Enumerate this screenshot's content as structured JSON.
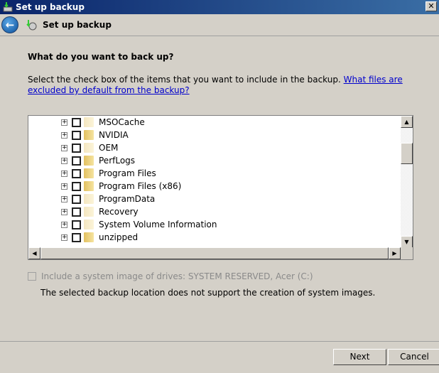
{
  "window": {
    "title": "Set up backup",
    "close": "✕"
  },
  "nav": {
    "title": "Set up backup",
    "back": "←"
  },
  "main": {
    "heading": "What do you want to back up?",
    "description": "Select the check box of the items that you want to include in the backup. ",
    "link": "What files are excluded by default from the backup?",
    "items": [
      {
        "label": "MSOCache",
        "hidden": true,
        "checked": false
      },
      {
        "label": "NVIDIA",
        "hidden": false,
        "checked": false
      },
      {
        "label": "OEM",
        "hidden": true,
        "checked": false
      },
      {
        "label": "PerfLogs",
        "hidden": false,
        "checked": false
      },
      {
        "label": "Program Files",
        "hidden": false,
        "checked": false
      },
      {
        "label": "Program Files (x86)",
        "hidden": false,
        "checked": false
      },
      {
        "label": "ProgramData",
        "hidden": true,
        "checked": false
      },
      {
        "label": "Recovery",
        "hidden": true,
        "checked": false
      },
      {
        "label": "System Volume Information",
        "hidden": true,
        "checked": false
      },
      {
        "label": "unzipped",
        "hidden": false,
        "checked": false
      }
    ],
    "system_image_label": "Include a system image of drives: SYSTEM RESERVED, Acer (C:)",
    "system_image_note": "The selected backup location does not support the creation of system images."
  },
  "footer": {
    "next": "Next",
    "cancel": "Cancel"
  }
}
